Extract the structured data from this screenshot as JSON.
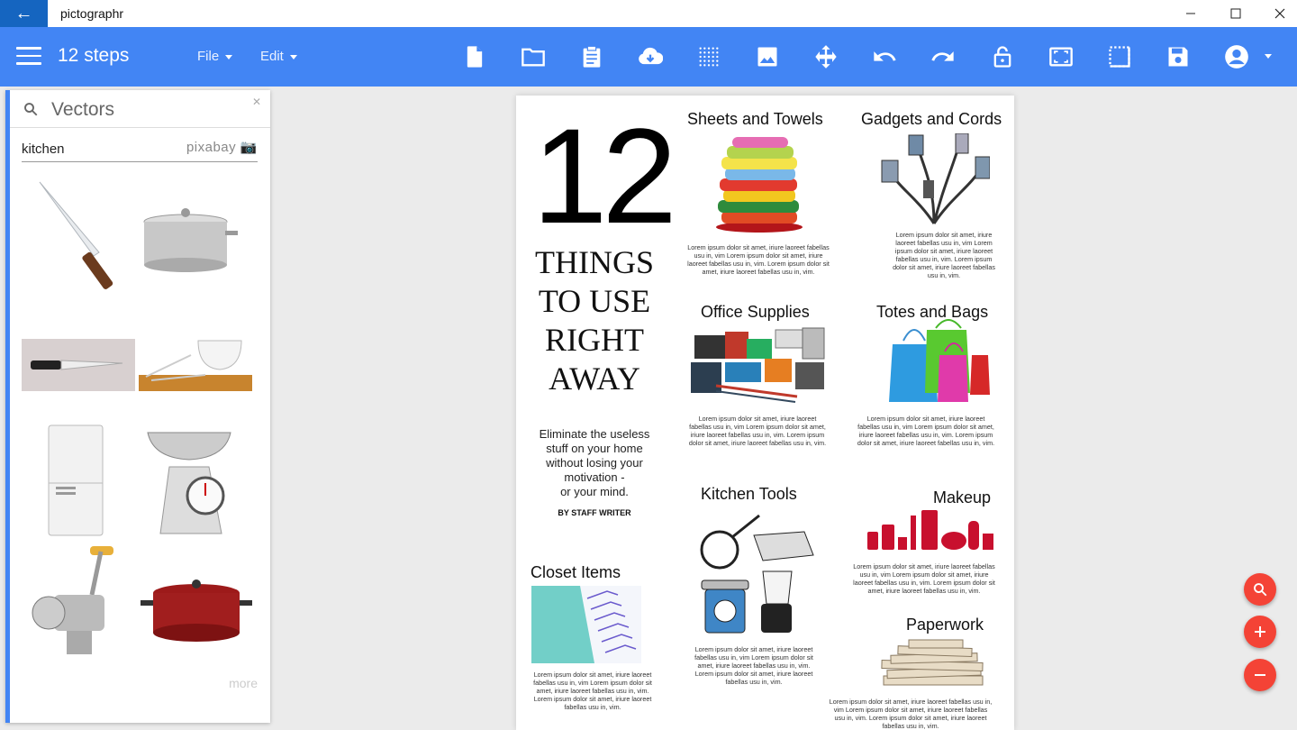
{
  "window": {
    "app_name": "pictographr"
  },
  "toolbar": {
    "doc_title": "12 steps",
    "menus": [
      {
        "label": "File"
      },
      {
        "label": "Edit"
      }
    ],
    "icons": [
      "new-document-icon",
      "open-folder-icon",
      "clipboard-icon",
      "cloud-download-icon",
      "grid-icon",
      "image-icon",
      "move-icon",
      "undo-icon",
      "redo-icon",
      "lock-icon",
      "fit-screen-icon",
      "crop-area-icon",
      "save-icon",
      "account-icon"
    ]
  },
  "panel": {
    "title": "Vectors",
    "search_value": "kitchen",
    "source": "pixabay",
    "more_label": "more",
    "items": [
      "chef knife",
      "stock pot",
      "kitchen knife",
      "bowl and chopsticks",
      "refrigerator",
      "kitchen scale",
      "meat grinder",
      "red casserole pot"
    ]
  },
  "poster": {
    "big_number": "12",
    "headline_lines": [
      "THINGS",
      "TO USE",
      "RIGHT",
      "AWAY"
    ],
    "subhead_lines": [
      "Eliminate the useless",
      "stuff on your home",
      "without losing your",
      "motivation  -",
      "or your mind."
    ],
    "byline": "BY STAFF WRITER",
    "sections": {
      "sheets": {
        "title": "Sheets and Towels",
        "body": "Lorem ipsum dolor sit amet, iriure laoreet fabellas usu in, vim Lorem ipsum dolor sit amet, iriure laoreet fabellas usu in, vim. Lorem ipsum dolor sit amet, iriure laoreet fabellas usu in, vim."
      },
      "gadgets": {
        "title": "Gadgets and Cords",
        "body": "Lorem ipsum dolor sit amet, iriure laoreet fabellas usu in, vim Lorem ipsum dolor sit amet, iriure laoreet fabellas usu in, vim. Lorem ipsum dolor sit amet, iriure laoreet fabellas usu in, vim."
      },
      "office": {
        "title": "Office Supplies",
        "body": "Lorem ipsum dolor sit amet, iriure laoreet fabellas usu in, vim Lorem ipsum dolor sit amet, iriure laoreet fabellas usu in, vim. Lorem ipsum dolor sit amet, iriure laoreet fabellas usu in, vim."
      },
      "totes": {
        "title": "Totes and Bags",
        "body": "Lorem ipsum dolor sit amet, iriure laoreet fabellas usu in, vim Lorem ipsum dolor sit amet, iriure laoreet fabellas usu in, vim. Lorem ipsum dolor sit amet, iriure laoreet fabellas usu in, vim."
      },
      "kitchen": {
        "title": "Kitchen Tools",
        "body": "Lorem ipsum dolor sit amet, iriure laoreet fabellas usu in, vim Lorem ipsum dolor sit amet, iriure laoreet fabellas usu in, vim. Lorem ipsum dolor sit amet, iriure laoreet fabellas usu in, vim."
      },
      "makeup": {
        "title": "Makeup",
        "body": "Lorem ipsum dolor sit amet, iriure laoreet fabellas usu in, vim Lorem ipsum dolor sit amet, iriure laoreet fabellas usu in, vim. Lorem ipsum dolor sit amet, iriure laoreet fabellas usu in, vim."
      },
      "closet": {
        "title": "Closet Items",
        "body": "Lorem ipsum dolor sit amet, iriure laoreet fabellas usu in, vim Lorem ipsum dolor sit amet, iriure laoreet fabellas usu in, vim. Lorem ipsum dolor sit amet, iriure laoreet fabellas usu in, vim."
      },
      "paperwork": {
        "title": "Paperwork",
        "body": "Lorem ipsum dolor sit amet, iriure laoreet fabellas usu in, vim Lorem ipsum dolor sit amet, iriure laoreet fabellas usu in, vim. Lorem ipsum dolor sit amet, iriure laoreet fabellas usu in, vim."
      }
    }
  },
  "fabs": [
    "search-icon",
    "zoom-in-icon",
    "zoom-out-icon"
  ],
  "colors": {
    "primary": "#4285f4",
    "title_accent": "#1565c0",
    "fab": "#f44336",
    "makeup": "#c8102e"
  }
}
